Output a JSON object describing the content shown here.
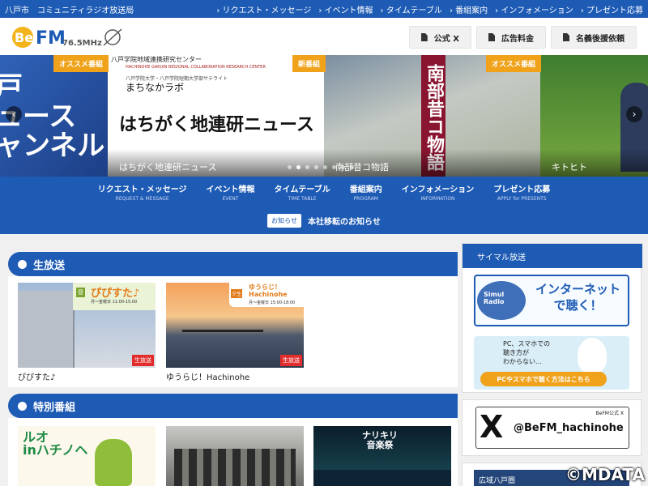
{
  "topbar": {
    "station": "八戸市　コミュニティラジオ放送局",
    "links": [
      "リクエスト・メッセージ",
      "イベント情報",
      "タイムテーブル",
      "番組案内",
      "インフォメーション",
      "プレゼント応募"
    ]
  },
  "header": {
    "logo_text": "BeFM",
    "logo_freq": "76.5MHz",
    "buttons": [
      "公式 X",
      "広告料金",
      "名義後援依頼"
    ]
  },
  "slider": {
    "slide1": {
      "text": "戸\nュース\nャンネル"
    },
    "slide2": {
      "tag": "オススメ番組",
      "org": "八戸学院地域連携研究センター",
      "org_en": "HACHINOHE GAKUIN REGIONAL COLLABORATION RESEARCH CENTER",
      "tiny": "八戸学院大学・八戸学院短期大学部サテライト",
      "program": "まちなかラボ",
      "headline": "はちがく地連研ニュース",
      "caption": "はちがく地連研ニュース"
    },
    "slide3": {
      "tag": "新番組",
      "banner": "南部昔コ物語",
      "caption": "南部昔コ物語"
    },
    "slide4": {
      "tag": "オススメ番組",
      "caption": "キトヒト"
    },
    "prev": "‹",
    "next": "›"
  },
  "nav": [
    {
      "jp": "リクエスト・メッセージ",
      "en": "REQUEST & MESSAGE"
    },
    {
      "jp": "イベント情報",
      "en": "EVENT"
    },
    {
      "jp": "タイムテーブル",
      "en": "TIME TABLE"
    },
    {
      "jp": "番組案内",
      "en": "PROGRAM"
    },
    {
      "jp": "インフォメーション",
      "en": "INFORMATION"
    },
    {
      "jp": "プレゼント応募",
      "en": "APPLY for PRESENTS"
    }
  ],
  "notice": {
    "badge": "お知らせ",
    "text": "本社移転のお知らせ"
  },
  "live": {
    "title": "生放送",
    "cards": [
      {
        "label": "ぴぴすた♪",
        "badge": "生放送",
        "img_title": "ぴぴすた♪",
        "img_sub": "月〜金曜日 11:00-15:00",
        "img_tag": "昼"
      },
      {
        "label": "ゆうらじ！Hachinohe",
        "badge": "生放送",
        "img_title": "ゆうらじ！\nHachinohe",
        "img_sub": "月〜金曜日 15:00-18:00",
        "img_tag": "夕生"
      }
    ]
  },
  "special": {
    "title": "特別番組",
    "cards": [
      {
        "img_text": "ルオ\ninハチノヘ"
      },
      {
        "img_text": ""
      },
      {
        "img_text": "ナリキリ\n音楽祭"
      }
    ]
  },
  "sidebar": {
    "simul_title": "サイマル放送",
    "simul_banner": "インターネット\nで聴く！",
    "simul_logo": "Simul\nRadio",
    "pc_text": "PC、スマホでの\n聴き方が\nわからない…",
    "pc_button": "PCやスマホで聴く方法はこちら",
    "x_label": "BeFM公式 X",
    "x_handle": "@BeFM_hachinohe",
    "bottom_text": "広域八戸圏"
  },
  "copyright": "©MDATA",
  "colors": {
    "primary": "#1e5bb5",
    "tag": "#f0a21a",
    "live": "#e32d2d"
  }
}
